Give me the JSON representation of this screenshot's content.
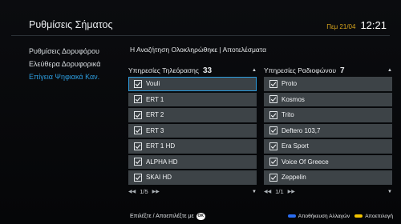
{
  "screen": {
    "title": "Ρυθμίσεις Σήματος",
    "date": "Πεμ 21/04",
    "time": "12:21"
  },
  "sidebar": {
    "items": [
      {
        "label": "Ρυθμίσεις Δορυφόρου",
        "active": false
      },
      {
        "label": "Ελεύθερα Δορυφορικά",
        "active": false
      },
      {
        "label": "Επίγεια Ψηφιακά Καν.",
        "active": true
      }
    ]
  },
  "main": {
    "headline": "Η Αναζήτηση Ολοκληρώθηκε | Αποτελέσματα",
    "tv": {
      "header": "Υπηρεσίες Τηλεόρασης",
      "count": "33",
      "items": [
        "Vouli",
        "ERT 1",
        "ERT 2",
        "ERT 3",
        "ERT 1 HD",
        "ALPHA HD",
        "SKAI HD"
      ],
      "page": "1/5"
    },
    "radio": {
      "header": "Υπηρεσίες Ραδιοφώνου",
      "count": "7",
      "items": [
        "Proto",
        "Kosmos",
        "Trito",
        "Deftero 103,7",
        "Era Sport",
        "Voice Of Greece",
        "Zeppelin"
      ],
      "page": "1/1"
    }
  },
  "footer": {
    "hint": "Επιλέξτε / Αποεπιλέξτε με",
    "ok_label": "OK",
    "save_label": "Αποθήκευση Αλλαγών",
    "deselect_label": "Αποεπιλογή",
    "save_color": "#2a6cf0",
    "deselect_color": "#f2c400"
  },
  "colors": {
    "accent": "#2c9bdd",
    "date": "#d6a41c"
  },
  "icons": {
    "checkbox": "checkbox-checked-icon",
    "scroll_up": "triangle-up-icon",
    "scroll_down": "triangle-down-icon",
    "page_prev": "double-left-arrow-icon",
    "page_next": "double-right-arrow-icon"
  }
}
